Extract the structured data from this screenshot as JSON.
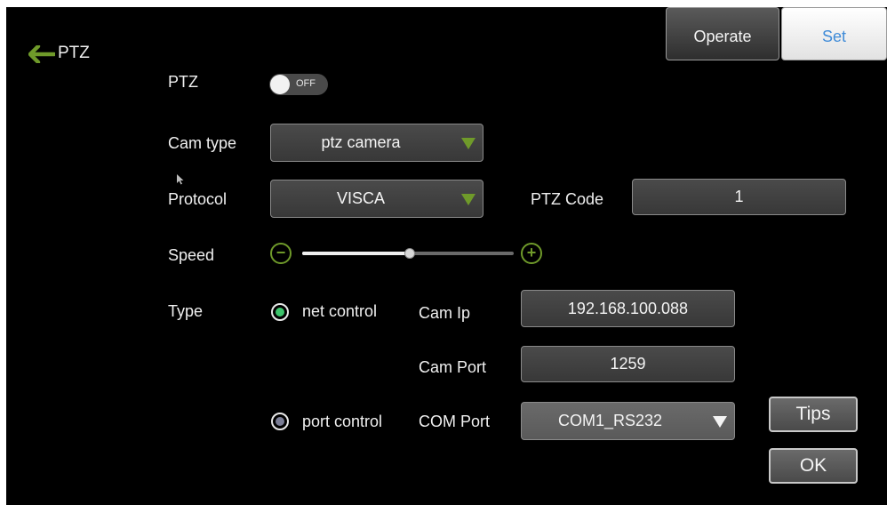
{
  "header": {
    "title": "PTZ"
  },
  "tabs": {
    "operate": "Operate",
    "set": "Set"
  },
  "ptz": {
    "label": "PTZ",
    "toggle_state": "OFF"
  },
  "cam_type": {
    "label": "Cam type",
    "value": "ptz camera"
  },
  "protocol": {
    "label": "Protocol",
    "value": "VISCA"
  },
  "ptz_code": {
    "label": "PTZ Code",
    "value": "1"
  },
  "speed": {
    "label": "Speed",
    "level_fraction": 0.51
  },
  "type": {
    "label": "Type",
    "net_control": "net control",
    "port_control": "port control",
    "selected": "net control"
  },
  "cam_ip": {
    "label": "Cam Ip",
    "value": "192.168.100.088"
  },
  "cam_port": {
    "label": "Cam Port",
    "value": "1259"
  },
  "com_port": {
    "label": "COM Port",
    "value": "COM1_RS232"
  },
  "buttons": {
    "tips": "Tips",
    "ok": "OK"
  },
  "colors": {
    "accent_green": "#6f9a2a",
    "radio_selected": "#3cc36b",
    "set_tab_text": "#3f8bd8"
  }
}
